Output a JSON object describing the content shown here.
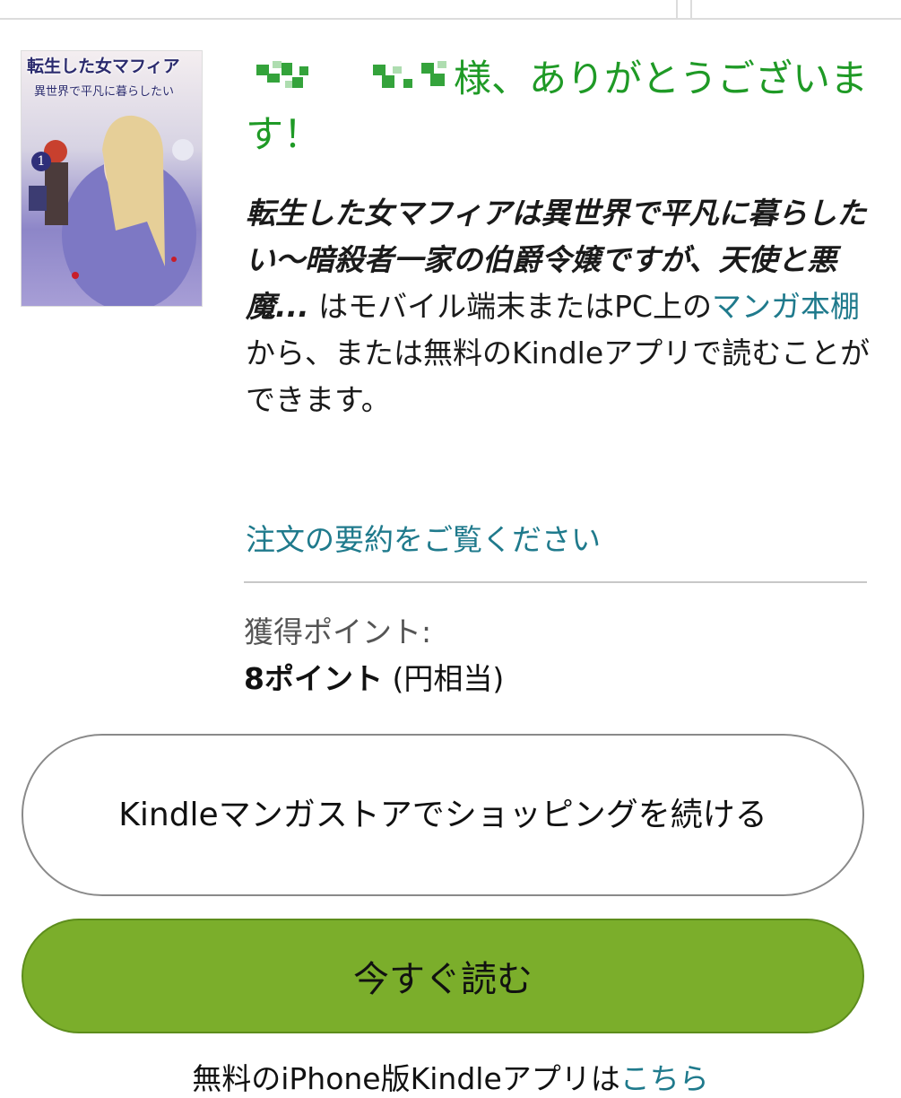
{
  "greeting": {
    "suffix": "様、ありがとうございます！"
  },
  "book": {
    "cover": {
      "title": "転生した女マフィア",
      "subtitle": "異世界で平凡に暮らしたい",
      "volume": "1"
    },
    "title": "転生した女マフィアは異世界で平凡に暮らしたい〜暗殺者一家の伯爵令嬢ですが、天使と悪魔..."
  },
  "message": {
    "part1": " はモバイル端末またはPC上の",
    "library_link": "マンガ本棚",
    "part2": "から、または無料のKindleアプリで読むことができます。"
  },
  "order_summary_link": "注文の要約をご覧ください",
  "points": {
    "label": "獲得ポイント:",
    "value": "8ポイント",
    "equivalent": "(円相当)"
  },
  "buttons": {
    "continue_shopping": "Kindleマンガストアでショッピングを続ける",
    "read_now": "今すぐ読む"
  },
  "footer": {
    "text": "無料のiPhone版Kindleアプリは",
    "link": "こちら"
  },
  "colors": {
    "greeting": "#1f9a26",
    "link": "#1f7a8c",
    "read_button": "#7bae2b"
  }
}
